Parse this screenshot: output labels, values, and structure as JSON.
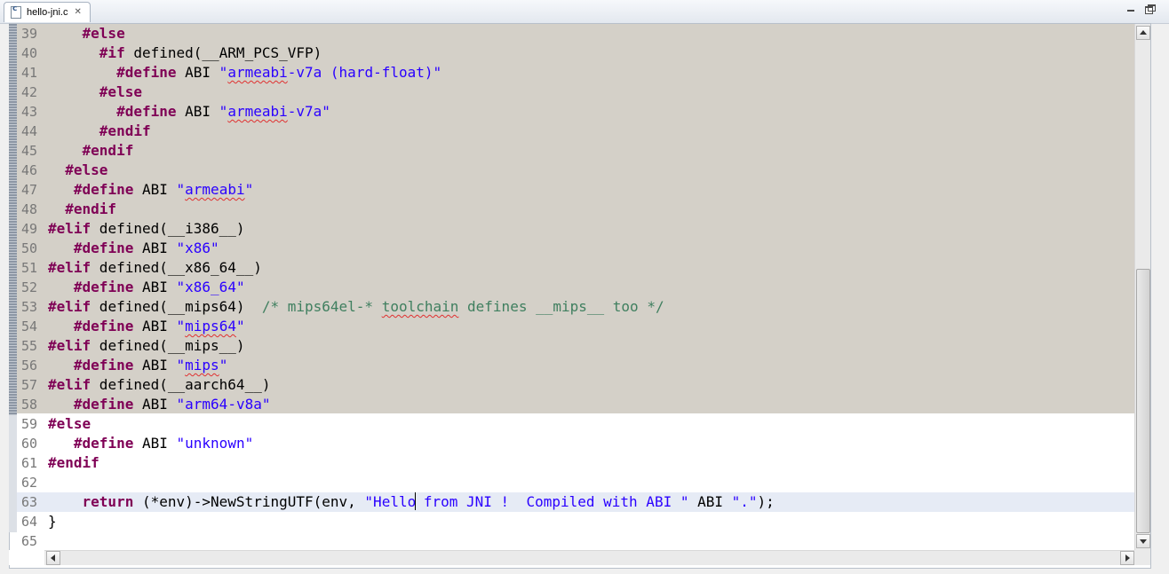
{
  "tab": {
    "title": "hello-jni.c",
    "close_icon": "close-icon",
    "file_icon": "c-source-file-icon"
  },
  "window_controls": {
    "minimize_icon": "minimize-icon",
    "maximize_icon": "maximize-icon"
  },
  "editor": {
    "current_line": 63,
    "folded_region_lines": "39-58",
    "colors": {
      "keyword": "#7f0055",
      "string": "#2a00ff",
      "comment": "#3f7f5f",
      "folded_background": "#d4d0c8",
      "current_line_background": "#e6ebf5",
      "line_number": "#787878"
    },
    "lines": [
      {
        "n": "39",
        "segs": [
          {
            "t": "    "
          },
          {
            "t": "#else",
            "c": "kw"
          }
        ]
      },
      {
        "n": "40",
        "segs": [
          {
            "t": "      "
          },
          {
            "t": "#if",
            "c": "kw"
          },
          {
            "t": " defined(__ARM_PCS_VFP)"
          }
        ]
      },
      {
        "n": "41",
        "segs": [
          {
            "t": "        "
          },
          {
            "t": "#define",
            "c": "kw"
          },
          {
            "t": " ABI "
          },
          {
            "t": "\"",
            "c": "str"
          },
          {
            "t": "armeabi",
            "c": "str sq"
          },
          {
            "t": "-v7a (hard-float)\"",
            "c": "str"
          }
        ]
      },
      {
        "n": "42",
        "segs": [
          {
            "t": "      "
          },
          {
            "t": "#else",
            "c": "kw"
          }
        ]
      },
      {
        "n": "43",
        "segs": [
          {
            "t": "        "
          },
          {
            "t": "#define",
            "c": "kw"
          },
          {
            "t": " ABI "
          },
          {
            "t": "\"",
            "c": "str"
          },
          {
            "t": "armeabi",
            "c": "str sq"
          },
          {
            "t": "-v7a\"",
            "c": "str"
          }
        ]
      },
      {
        "n": "44",
        "segs": [
          {
            "t": "      "
          },
          {
            "t": "#endif",
            "c": "kw"
          }
        ]
      },
      {
        "n": "45",
        "segs": [
          {
            "t": "    "
          },
          {
            "t": "#endif",
            "c": "kw"
          }
        ]
      },
      {
        "n": "46",
        "segs": [
          {
            "t": "  "
          },
          {
            "t": "#else",
            "c": "kw"
          }
        ]
      },
      {
        "n": "47",
        "segs": [
          {
            "t": "   "
          },
          {
            "t": "#define",
            "c": "kw"
          },
          {
            "t": " ABI "
          },
          {
            "t": "\"",
            "c": "str"
          },
          {
            "t": "armeabi",
            "c": "str sq"
          },
          {
            "t": "\"",
            "c": "str"
          }
        ]
      },
      {
        "n": "48",
        "segs": [
          {
            "t": "  "
          },
          {
            "t": "#endif",
            "c": "kw"
          }
        ]
      },
      {
        "n": "49",
        "segs": [
          {
            "t": "#elif",
            "c": "kw"
          },
          {
            "t": " defined(__i386__)"
          }
        ]
      },
      {
        "n": "50",
        "segs": [
          {
            "t": "   "
          },
          {
            "t": "#define",
            "c": "kw"
          },
          {
            "t": " ABI "
          },
          {
            "t": "\"x86\"",
            "c": "str"
          }
        ]
      },
      {
        "n": "51",
        "segs": [
          {
            "t": "#elif",
            "c": "kw"
          },
          {
            "t": " defined(__x86_64__)"
          }
        ]
      },
      {
        "n": "52",
        "segs": [
          {
            "t": "   "
          },
          {
            "t": "#define",
            "c": "kw"
          },
          {
            "t": " ABI "
          },
          {
            "t": "\"x86_64\"",
            "c": "str"
          }
        ]
      },
      {
        "n": "53",
        "segs": [
          {
            "t": "#elif",
            "c": "kw"
          },
          {
            "t": " defined(__mips64)  "
          },
          {
            "t": "/* mips64el-* ",
            "c": "cmt"
          },
          {
            "t": "toolchain",
            "c": "cmt sq"
          },
          {
            "t": " defines __mips__ too */",
            "c": "cmt"
          }
        ]
      },
      {
        "n": "54",
        "segs": [
          {
            "t": "   "
          },
          {
            "t": "#define",
            "c": "kw"
          },
          {
            "t": " ABI "
          },
          {
            "t": "\"",
            "c": "str"
          },
          {
            "t": "mips64",
            "c": "str sq"
          },
          {
            "t": "\"",
            "c": "str"
          }
        ]
      },
      {
        "n": "55",
        "segs": [
          {
            "t": "#elif",
            "c": "kw"
          },
          {
            "t": " defined(__mips__)"
          }
        ]
      },
      {
        "n": "56",
        "segs": [
          {
            "t": "   "
          },
          {
            "t": "#define",
            "c": "kw"
          },
          {
            "t": " ABI "
          },
          {
            "t": "\"",
            "c": "str"
          },
          {
            "t": "mips",
            "c": "str sq"
          },
          {
            "t": "\"",
            "c": "str"
          }
        ]
      },
      {
        "n": "57",
        "segs": [
          {
            "t": "#elif",
            "c": "kw"
          },
          {
            "t": " defined(__aarch64__)"
          }
        ]
      },
      {
        "n": "58",
        "segs": [
          {
            "t": "   "
          },
          {
            "t": "#define",
            "c": "kw"
          },
          {
            "t": " ABI "
          },
          {
            "t": "\"arm64-v8a\"",
            "c": "str"
          }
        ]
      },
      {
        "n": "59",
        "segs": [
          {
            "t": "#else",
            "c": "kw"
          }
        ]
      },
      {
        "n": "60",
        "segs": [
          {
            "t": "   "
          },
          {
            "t": "#define",
            "c": "kw"
          },
          {
            "t": " ABI "
          },
          {
            "t": "\"unknown\"",
            "c": "str"
          }
        ]
      },
      {
        "n": "61",
        "segs": [
          {
            "t": "#endif",
            "c": "kw"
          }
        ]
      },
      {
        "n": "62",
        "segs": []
      },
      {
        "n": "63",
        "segs": [
          {
            "t": "    "
          },
          {
            "t": "return",
            "c": "kw"
          },
          {
            "t": " (*env)->NewStringUTF(env, "
          },
          {
            "t": "\"Hello",
            "c": "str"
          },
          {
            "t": "",
            "c": "caret"
          },
          {
            "t": " from JNI !  Compiled with ABI \"",
            "c": "str"
          },
          {
            "t": " ABI "
          },
          {
            "t": "\".\"",
            "c": "str"
          },
          {
            "t": ");"
          }
        ]
      },
      {
        "n": "64",
        "segs": [
          {
            "t": "}"
          }
        ]
      },
      {
        "n": "65",
        "segs": []
      }
    ]
  },
  "scrollbars": {
    "vertical": {
      "up_icon": "arrow-up-icon",
      "down_icon": "arrow-down-icon"
    },
    "horizontal": {
      "left_icon": "arrow-left-icon",
      "right_icon": "arrow-right-icon"
    }
  }
}
